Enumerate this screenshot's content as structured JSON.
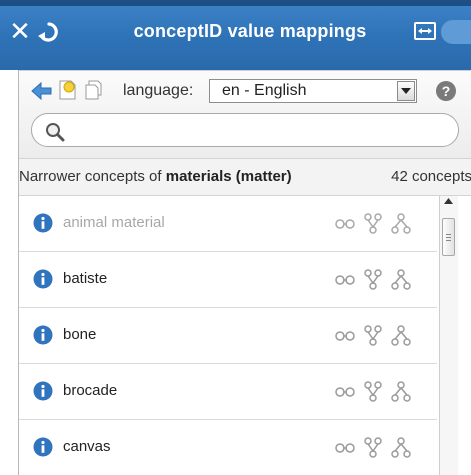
{
  "titlebar": {
    "title": "conceptID value mappings"
  },
  "toolbar": {
    "language_label": "language:",
    "language_value": "en - English",
    "help_label": "?"
  },
  "search": {
    "placeholder": ""
  },
  "subheader": {
    "prefix": "Narrower concepts of ",
    "concept": "materials (matter)",
    "count": "42 concepts"
  },
  "list": {
    "items": [
      {
        "label": "animal material",
        "state": "disabled"
      },
      {
        "label": "batiste"
      },
      {
        "label": "bone"
      },
      {
        "label": "brocade"
      },
      {
        "label": "canvas"
      }
    ]
  },
  "colors": {
    "titlebar": "#2f73b8",
    "info_icon": "#2f74bd",
    "mapping_icon": "#9a9a9a",
    "dim_text": "#a8a8a8"
  },
  "icons": [
    "close-icon",
    "back-icon",
    "expand-icon",
    "back-arrow-icon",
    "new-concept-icon",
    "copy-icon",
    "dropdown-arrow-icon",
    "help-icon",
    "search-icon",
    "info-icon",
    "link-icon",
    "hierarchy-icon",
    "tree-icon",
    "scroll-up-icon"
  ]
}
